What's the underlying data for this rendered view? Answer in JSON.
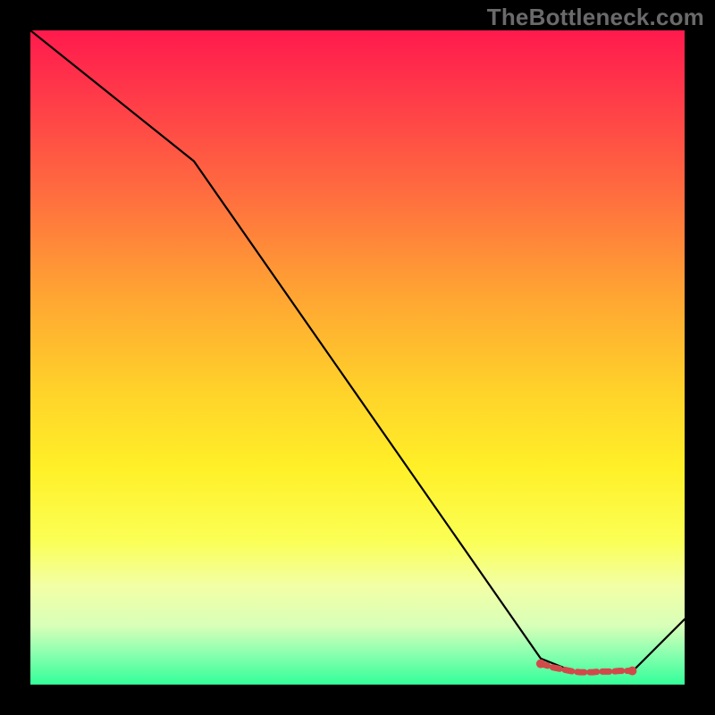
{
  "watermark": "TheBottleneck.com",
  "chart_data": {
    "type": "line",
    "title": "",
    "xlabel": "",
    "ylabel": "",
    "xlim": [
      0,
      100
    ],
    "ylim": [
      0,
      100
    ],
    "grid": false,
    "legend": false,
    "background_gradient": {
      "top_color": "#ff1a4d",
      "bottom_color": "#33ff99"
    },
    "series": [
      {
        "name": "bottleneck-curve",
        "stroke": "#000000",
        "x": [
          0,
          25,
          78,
          83,
          92,
          100
        ],
        "values": [
          100,
          80,
          4,
          2,
          2,
          10
        ]
      }
    ],
    "markers": {
      "name": "selected-range",
      "stroke": "#d14a4a",
      "fill": "#d14a4a",
      "x": [
        78,
        79,
        80,
        81,
        82,
        83,
        84,
        85,
        86,
        87,
        88,
        89,
        90,
        91,
        92
      ],
      "values": [
        3.2,
        2.9,
        2.6,
        2.4,
        2.2,
        2.0,
        1.9,
        1.9,
        1.9,
        2.0,
        2.0,
        2.0,
        2.1,
        2.1,
        2.1
      ]
    }
  }
}
